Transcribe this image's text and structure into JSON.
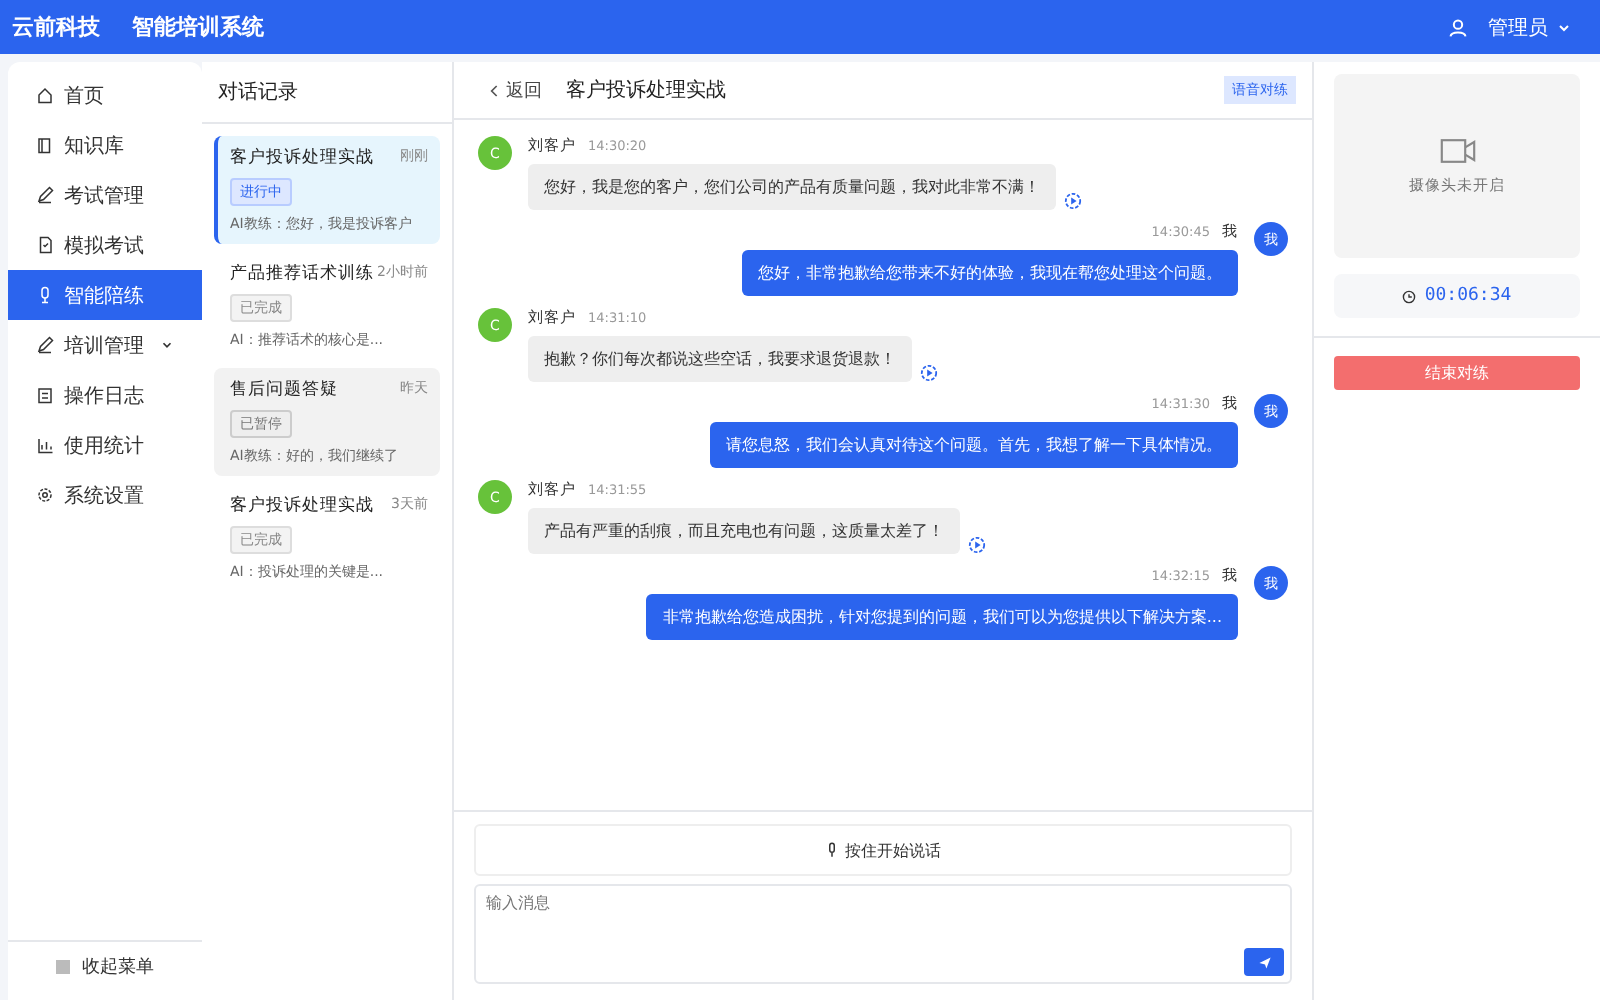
{
  "header": {
    "brand": "云前科技",
    "system": "智能培训系统",
    "user": "管理员"
  },
  "sidebar": {
    "items": [
      {
        "label": "首页",
        "kind": "home",
        "selected": false,
        "expandable": false
      },
      {
        "label": "知识库",
        "kind": "book",
        "selected": false,
        "expandable": false
      },
      {
        "label": "考试管理",
        "kind": "edit",
        "selected": false,
        "expandable": false
      },
      {
        "label": "模拟考试",
        "kind": "doc",
        "selected": false,
        "expandable": false
      },
      {
        "label": "智能陪练",
        "kind": "mic",
        "selected": true,
        "expandable": false
      },
      {
        "label": "培训管理",
        "kind": "edit",
        "selected": false,
        "expandable": true
      },
      {
        "label": "操作日志",
        "kind": "log",
        "selected": false,
        "expandable": false
      },
      {
        "label": "使用统计",
        "kind": "chart",
        "selected": false,
        "expandable": false
      },
      {
        "label": "系统设置",
        "kind": "gear",
        "selected": false,
        "expandable": false
      }
    ],
    "collapse": "收起菜单"
  },
  "history": {
    "title": "对话记录",
    "items": [
      {
        "title": "客户投诉处理实战",
        "time": "刚刚",
        "tag": "进行中",
        "kind": "active",
        "preview": "AI教练：您好，我是投诉客户",
        "selected": true
      },
      {
        "title": "产品推荐话术训练",
        "time": "2小时前",
        "tag": "已完成",
        "kind": "done",
        "preview": "AI：推荐话术的核心是...",
        "selected": false
      },
      {
        "title": "售后问题答疑",
        "time": "昨天",
        "tag": "已暂停",
        "kind": "paused",
        "preview": "AI教练：好的，我们继续了",
        "selected": false,
        "hovered": true
      },
      {
        "title": "客户投诉处理实战",
        "time": "3天前",
        "tag": "已完成",
        "kind": "done",
        "preview": "AI：投诉处理的关键是...",
        "selected": false
      }
    ]
  },
  "chat": {
    "back": "返回",
    "title": "客户投诉处理实战",
    "badge": "语音对练",
    "messages": [
      {
        "kind": "ai",
        "avatar": "C",
        "name": "刘客户",
        "time": "14:30:20",
        "text": "您好，我是您的客户，您们公司的产品有质量问题，我对此非常不满！"
      },
      {
        "kind": "me",
        "avatar": "我",
        "name": "我",
        "time": "14:30:45",
        "text": "您好，非常抱歉给您带来不好的体验，我现在帮您处理这个问题。"
      },
      {
        "kind": "ai",
        "avatar": "C",
        "name": "刘客户",
        "time": "14:31:10",
        "text": "抱歉？你们每次都说这些空话，我要求退货退款！"
      },
      {
        "kind": "me",
        "avatar": "我",
        "name": "我",
        "time": "14:31:30",
        "text": "请您息怒，我们会认真对待这个问题。首先，我想了解一下具体情况。"
      },
      {
        "kind": "ai",
        "avatar": "C",
        "name": "刘客户",
        "time": "14:31:55",
        "text": "产品有严重的刮痕，而且充电也有问题，这质量太差了！"
      },
      {
        "kind": "me",
        "avatar": "我",
        "name": "我",
        "time": "14:32:15",
        "text": "非常抱歉给您造成困扰，针对您提到的问题，我们可以为您提供以下解决方案..."
      }
    ],
    "voice_button": "按住开始说话",
    "input": {
      "placeholder": "输入消息"
    }
  },
  "side": {
    "camera": "摄像头未开启",
    "timer": "00:06:34",
    "end_button": "结束对练"
  }
}
